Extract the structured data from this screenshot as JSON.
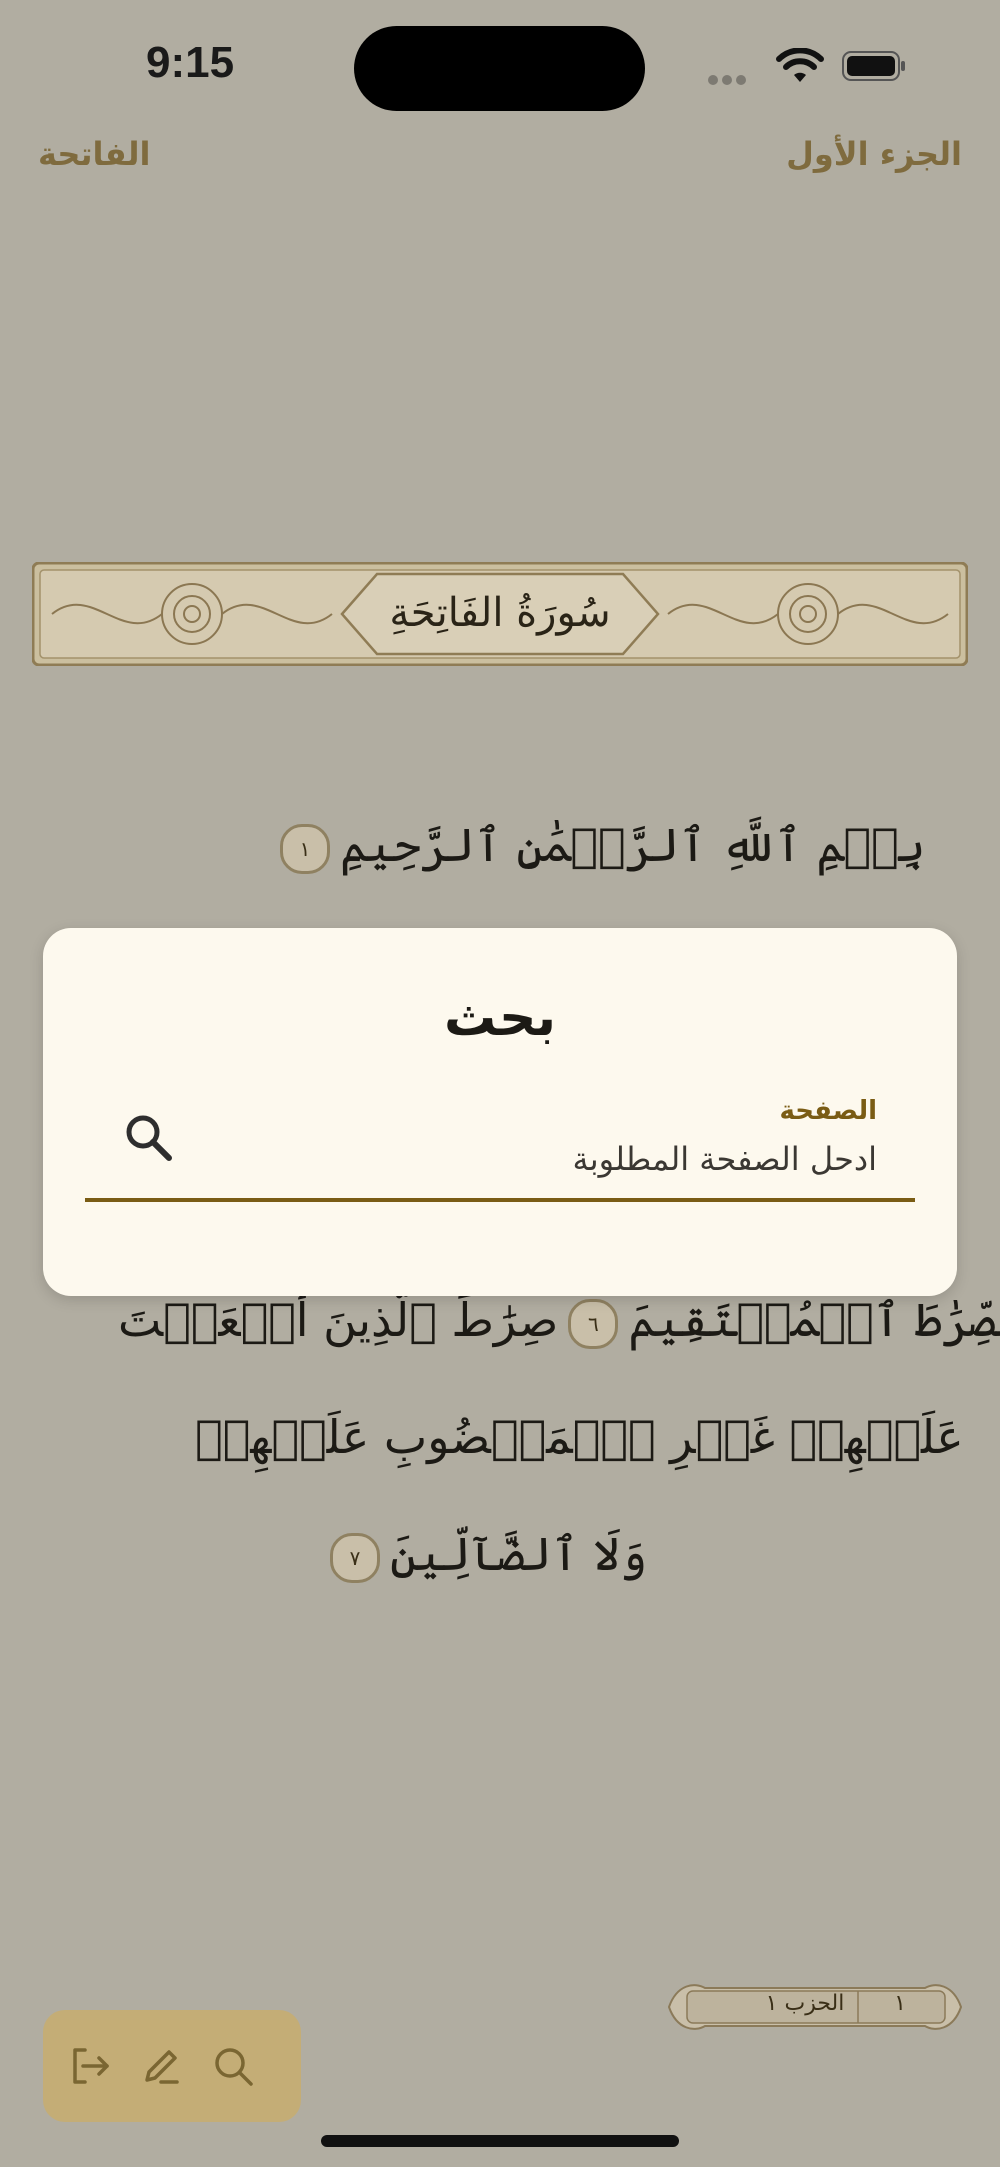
{
  "status_bar": {
    "time": "9:15"
  },
  "header": {
    "surah_name": "الفاتحة",
    "juz_name": "الجزء الأول"
  },
  "page": {
    "surah_title": "سُورَةُ الفَاتِحَةِ",
    "lines": [
      {
        "text": "بِسۡمِ ٱللَّهِ ٱلرَّحۡمَٰنِ ٱلرَّحِيمِ",
        "ayah": "١"
      },
      {
        "text": "ٱلصِّرَٰطَ ٱلۡمُسۡتَقِيمَ",
        "ayah": "٦",
        "text2": "صِرَٰطَ ٱلَّذِينَ أَنۡعَمۡتَ"
      },
      {
        "text": "عَلَيۡهِمۡ غَيۡرِ ٱلۡمَغۡضُوبِ عَلَيۡهِمۡ"
      },
      {
        "text": "وَلَا ٱلضَّآلِّينَ",
        "ayah": "٧"
      }
    ]
  },
  "dialog": {
    "title": "بحث",
    "field_label": "الصفحة",
    "field_placeholder": "ادحل الصفحة المطلوبة",
    "search_icon": "search-icon"
  },
  "footer": {
    "hizb_label": "الحزب ١",
    "juz_number": "١"
  },
  "toolbar": {
    "icons": [
      "logout-icon",
      "edit-icon",
      "search-icon"
    ]
  },
  "colors": {
    "accent": "#7a5c14",
    "background": "#b1ada1",
    "dialog_bg": "#fdf9ee",
    "toolbar_bg": "#c4ad76"
  }
}
